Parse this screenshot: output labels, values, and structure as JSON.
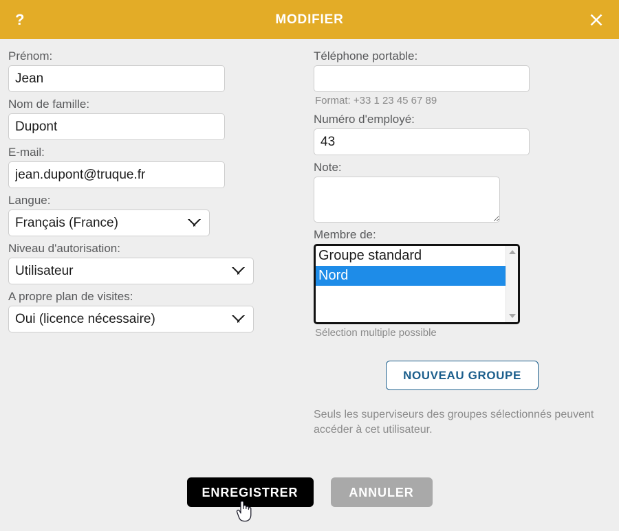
{
  "window": {
    "title": "MODIFIER",
    "help_icon": "question-mark-icon",
    "close_icon": "close-icon",
    "header_color": "#e3ac27"
  },
  "left_column": {
    "first_name": {
      "label": "Prénom:",
      "value": "Jean",
      "placeholder": ""
    },
    "last_name": {
      "label": "Nom de famille:",
      "value": "Dupont",
      "placeholder": ""
    },
    "email": {
      "label": "E-mail:",
      "value": "jean.dupont@truque.fr",
      "placeholder": ""
    },
    "language": {
      "label": "Langue:",
      "value": "Français (France)",
      "options": [
        "Français (France)"
      ]
    },
    "authorization_level": {
      "label": "Niveau d'autorisation:",
      "value": "Utilisateur",
      "options": [
        "Utilisateur"
      ]
    },
    "own_visit_plan": {
      "label": "A propre plan de visites:",
      "value": "Oui (licence nécessaire)",
      "options": [
        "Oui (licence nécessaire)"
      ]
    }
  },
  "right_column": {
    "mobile_phone": {
      "label": "Téléphone portable:",
      "value": "",
      "placeholder": "",
      "hint": "Format: +33 1 23 45 67 89"
    },
    "employee_number": {
      "label": "Numéro d'employé:",
      "value": "43",
      "placeholder": ""
    },
    "note": {
      "label": "Note:",
      "value": "",
      "placeholder": ""
    },
    "member_of": {
      "label": "Membre de:",
      "hint": "Sélection multiple possible",
      "items": [
        {
          "label": "Groupe standard",
          "selected": false
        },
        {
          "label": "Nord",
          "selected": true
        }
      ],
      "selected_color": "#1e8ce8"
    },
    "new_group_button": {
      "label": "NOUVEAU GROUPE",
      "color": "#1b5e8c"
    },
    "supervisor_note": "Seuls les superviseurs des groupes sélectionnés peuvent accéder à cet utilisateur."
  },
  "actions": {
    "save_label": "ENREGISTRER",
    "cancel_label": "ANNULER",
    "save_color": "#000000",
    "cancel_color": "#a9a9a9"
  },
  "cursor": {
    "type": "pointing-hand-cursor"
  }
}
